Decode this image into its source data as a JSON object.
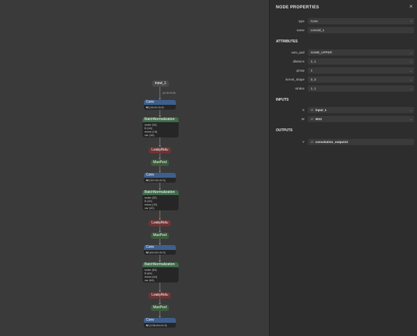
{
  "graph": {
    "input_label": "input_1",
    "input_shape": "(1×3×3×3)",
    "blocks": [
      {
        "conv": {
          "title": "Conv",
          "w_label": "W",
          "w_shape": "(16×3×3×3)"
        },
        "bn": {
          "title": "BatchNormalization",
          "rows": [
            {
              "k": "scale",
              "v": "(16)"
            },
            {
              "k": "B",
              "v": "(16)"
            },
            {
              "k": "mean",
              "v": "(16)"
            },
            {
              "k": "var",
              "v": "(16)"
            }
          ]
        },
        "relu": "LeakyRelu",
        "pool": "MaxPool"
      },
      {
        "conv": {
          "title": "Conv",
          "w_label": "W",
          "w_shape": "(32×16×3×3)"
        },
        "bn": {
          "title": "BatchNormalization",
          "rows": [
            {
              "k": "scale",
              "v": "(32)"
            },
            {
              "k": "B",
              "v": "(32)"
            },
            {
              "k": "mean",
              "v": "(32)"
            },
            {
              "k": "var",
              "v": "(32)"
            }
          ]
        },
        "relu": "LeakyRelu",
        "pool": "MaxPool"
      },
      {
        "conv": {
          "title": "Conv",
          "w_label": "W",
          "w_shape": "(64×32×3×3)"
        },
        "bn": {
          "title": "BatchNormalization",
          "rows": [
            {
              "k": "scale",
              "v": "(64)"
            },
            {
              "k": "B",
              "v": "(64)"
            },
            {
              "k": "mean",
              "v": "(64)"
            },
            {
              "k": "var",
              "v": "(64)"
            }
          ]
        },
        "relu": "LeakyRelu",
        "pool": "MaxPool"
      }
    ],
    "last_conv": {
      "title": "Conv",
      "w_label": "W",
      "w_shape": "(128×64×3×3)"
    }
  },
  "panel": {
    "title": "NODE PROPERTIES",
    "close_icon": "×",
    "props": [
      {
        "label": "type",
        "value": "Conv",
        "chevron": "?"
      },
      {
        "label": "name",
        "value": "conv2d_1",
        "chevron": ""
      }
    ],
    "attributes_heading": "ATTRIBUTES",
    "attributes": [
      {
        "label": "auto_pad",
        "value": "SAME_UPPER"
      },
      {
        "label": "dilations",
        "value": "1, 1"
      },
      {
        "label": "group",
        "value": "1"
      },
      {
        "label": "kernel_shape",
        "value": "3, 3"
      },
      {
        "label": "strides",
        "value": "1, 1"
      }
    ],
    "inputs_heading": "INPUTS",
    "inputs": [
      {
        "label": "X",
        "prefix": "id:",
        "value": "input_1"
      },
      {
        "label": "W",
        "prefix": "id:",
        "value": "W12"
      }
    ],
    "outputs_heading": "OUTPUTS",
    "outputs": [
      {
        "label": "Y",
        "prefix": "id:",
        "value": "convolution_output12"
      }
    ],
    "chevron_icon": "⌄"
  },
  "colors": {
    "conv": "#3e5f8c",
    "bn": "#3f6b4a",
    "relu": "#6e3434",
    "pool": "#3b5a3b",
    "input": "#4a4a4a"
  }
}
